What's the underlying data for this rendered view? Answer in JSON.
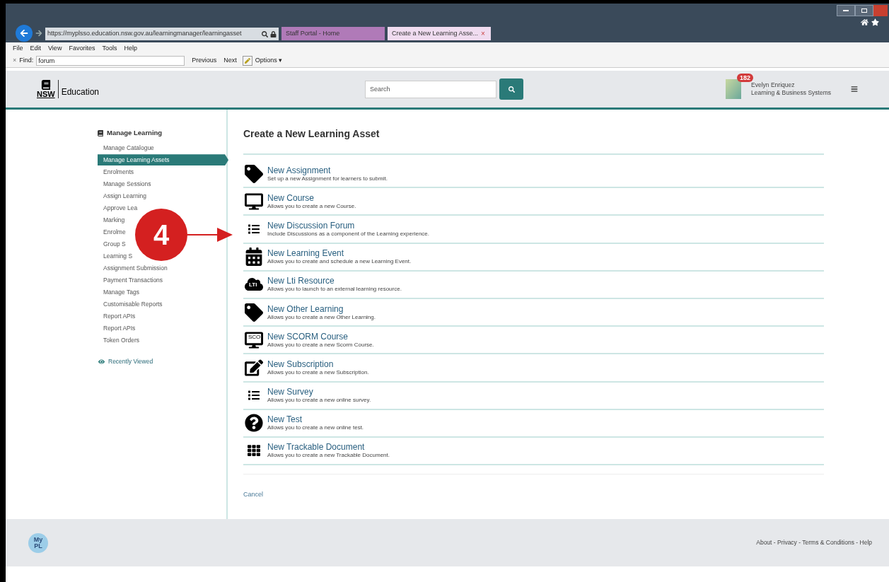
{
  "browser": {
    "address": "https://myplsso.education.nsw.gov.au/learningmanager/learningasset",
    "tabs": [
      {
        "label": "Staff Portal - Home",
        "selected": false
      },
      {
        "label": "Create a New Learning Asse...",
        "selected": true
      }
    ],
    "close_glyph": "×",
    "menu": [
      "File",
      "Edit",
      "View",
      "Favorites",
      "Tools",
      "Help"
    ],
    "find": {
      "close_glyph": "×",
      "label": "Find:",
      "value": "forum",
      "buttons": [
        "Previous",
        "Next"
      ],
      "options": "Options",
      "caret": "▾"
    }
  },
  "header": {
    "logo_mark": "NSW",
    "logo_text": "Education",
    "search": {
      "placeholder": "Search"
    },
    "user": {
      "notifications": "182",
      "name": "Evelyn Enriquez",
      "unit": "Learning & Business Systems"
    }
  },
  "sidebar": {
    "title": "Manage Learning",
    "items": [
      {
        "label": "Manage Catalogue",
        "selected": false
      },
      {
        "label": "Manage Learning Assets",
        "selected": true
      },
      {
        "label": "Enrolments",
        "selected": false
      },
      {
        "label": "Manage Sessions",
        "selected": false
      },
      {
        "label": "Assign Learning",
        "selected": false
      },
      {
        "label": "Approve Lea",
        "selected": false
      },
      {
        "label": "Marking",
        "selected": false
      },
      {
        "label": "Enrolme",
        "selected": false
      },
      {
        "label": "Group S",
        "selected": false
      },
      {
        "label": "Learning S",
        "selected": false
      },
      {
        "label": "Assignment Submission",
        "selected": false
      },
      {
        "label": "Payment Transactions",
        "selected": false
      },
      {
        "label": "Manage Tags",
        "selected": false
      },
      {
        "label": "Customisable Reports",
        "selected": false
      },
      {
        "label": "Report APIs",
        "selected": false
      },
      {
        "label": "Report APIs",
        "selected": false
      },
      {
        "label": "Token Orders",
        "selected": false
      }
    ],
    "recent": "Recently Viewed"
  },
  "callout": {
    "number": "4"
  },
  "main": {
    "title": "Create a New Learning Asset",
    "assets": [
      {
        "kind": "tag",
        "name": "New Assignment",
        "description": "Set up a new Assignment for learners to submit."
      },
      {
        "kind": "monitor",
        "name": "New Course",
        "description": "Allows you to create a new Course."
      },
      {
        "kind": "list",
        "name": "New Discussion Forum",
        "description": "Include Discussions as a component of the Learning experience."
      },
      {
        "kind": "calendar",
        "name": "New Learning Event",
        "description": "Allows you to create and schedule a new Learning Event."
      },
      {
        "kind": "cloud",
        "icon_text": "LTI",
        "name": "New Lti Resource",
        "description": "Allows you to launch to an external learning resource."
      },
      {
        "kind": "tag",
        "name": "New Other Learning",
        "description": "Allows you to create a new Other Learning."
      },
      {
        "kind": "monitor",
        "icon_text": "SCO",
        "name": "New SCORM Course",
        "description": "Allows you to create a new Scorm Course."
      },
      {
        "kind": "edit",
        "name": "New Subscription",
        "description": "Allows you to create a new Subscription."
      },
      {
        "kind": "list",
        "name": "New Survey",
        "description": "Allows you to create a new online survey."
      },
      {
        "kind": "question",
        "name": "New Test",
        "description": "Allows you to create a new online test."
      },
      {
        "kind": "document",
        "name": "New Trackable Document",
        "description": "Allows you to create a new Trackable Document."
      }
    ],
    "cancel": "Cancel"
  },
  "footer": {
    "logo_top": "My",
    "logo_bottom": "PL",
    "links": "About - Privacy - Terms & Conditions - Help"
  }
}
